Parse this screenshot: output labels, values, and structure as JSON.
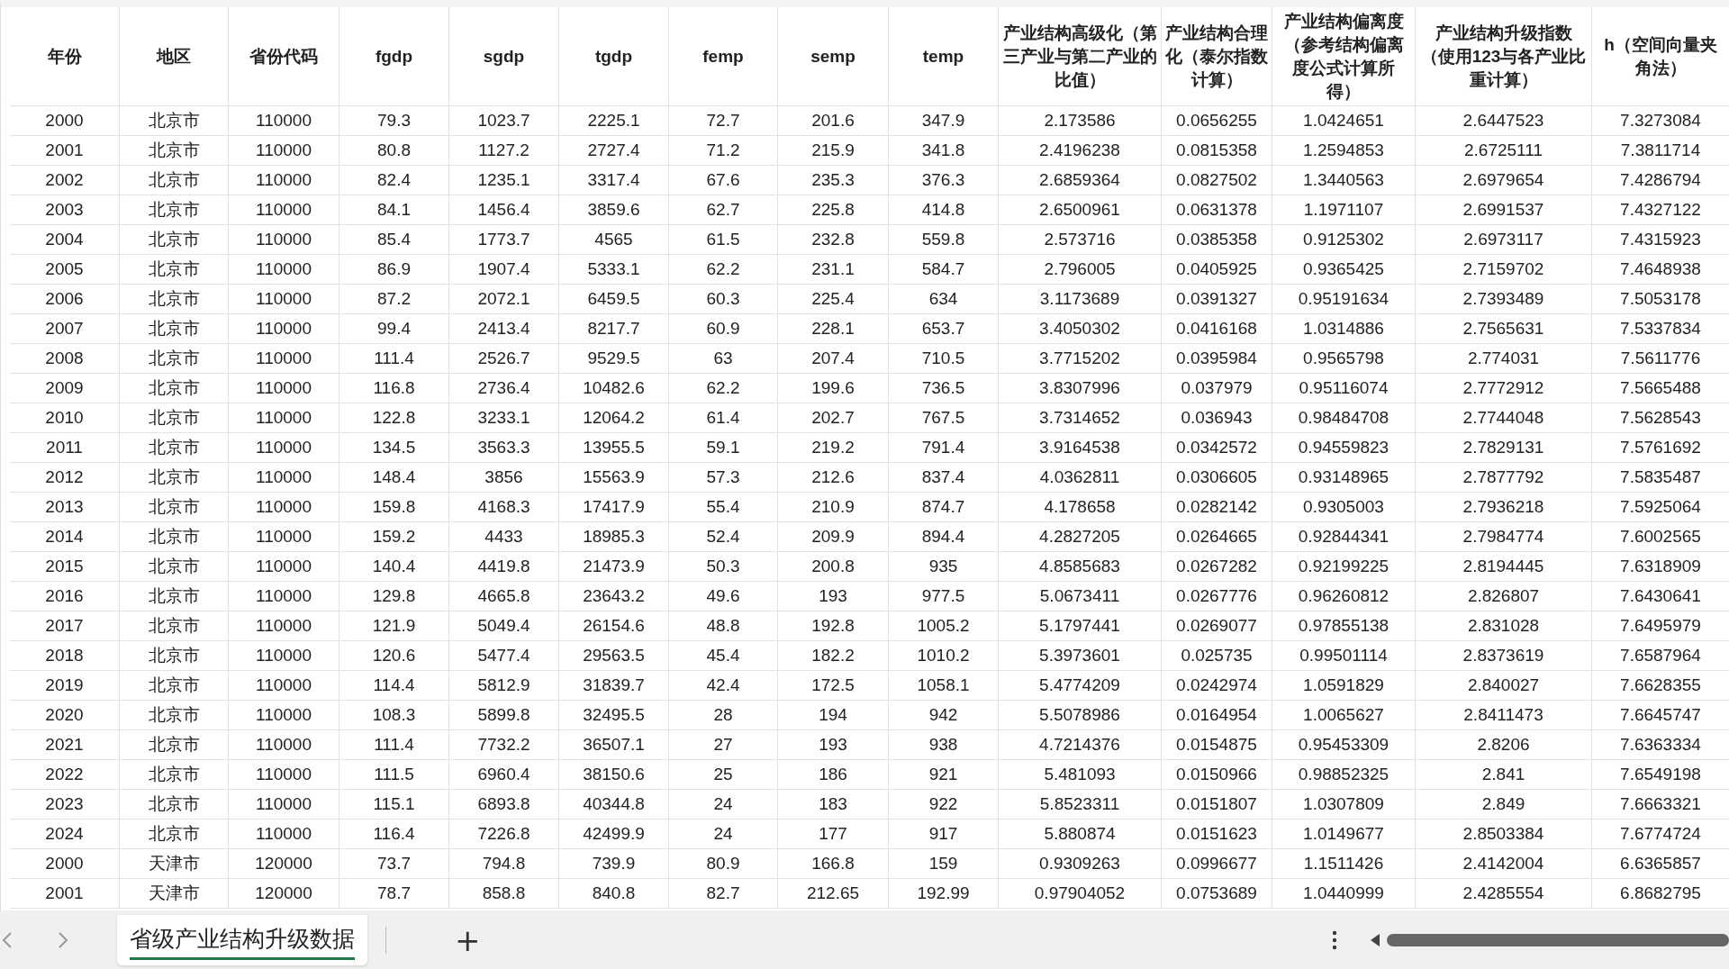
{
  "table": {
    "columns": [
      "年份",
      "地区",
      "省份代码",
      "fgdp",
      "sgdp",
      "tgdp",
      "femp",
      "semp",
      "temp",
      "产业结构高级化（第三产业与第二产业的比值）",
      "产业结构合理化（泰尔指数计算）",
      "产业结构偏离度（参考结构偏离度公式计算所得）",
      "产业结构升级指数（使用123与各产业比重计算）",
      "h（空间向量夹角法）"
    ],
    "rows": [
      [
        "2000",
        "北京市",
        "110000",
        "79.3",
        "1023.7",
        "2225.1",
        "72.7",
        "201.6",
        "347.9",
        "2.173586",
        "0.0656255",
        "1.0424651",
        "2.6447523",
        "7.3273084"
      ],
      [
        "2001",
        "北京市",
        "110000",
        "80.8",
        "1127.2",
        "2727.4",
        "71.2",
        "215.9",
        "341.8",
        "2.4196238",
        "0.0815358",
        "1.2594853",
        "2.6725111",
        "7.3811714"
      ],
      [
        "2002",
        "北京市",
        "110000",
        "82.4",
        "1235.1",
        "3317.4",
        "67.6",
        "235.3",
        "376.3",
        "2.6859364",
        "0.0827502",
        "1.3440563",
        "2.6979654",
        "7.4286794"
      ],
      [
        "2003",
        "北京市",
        "110000",
        "84.1",
        "1456.4",
        "3859.6",
        "62.7",
        "225.8",
        "414.8",
        "2.6500961",
        "0.0631378",
        "1.1971107",
        "2.6991537",
        "7.4327122"
      ],
      [
        "2004",
        "北京市",
        "110000",
        "85.4",
        "1773.7",
        "4565",
        "61.5",
        "232.8",
        "559.8",
        "2.573716",
        "0.0385358",
        "0.9125302",
        "2.6973117",
        "7.4315923"
      ],
      [
        "2005",
        "北京市",
        "110000",
        "86.9",
        "1907.4",
        "5333.1",
        "62.2",
        "231.1",
        "584.7",
        "2.796005",
        "0.0405925",
        "0.9365425",
        "2.7159702",
        "7.4648938"
      ],
      [
        "2006",
        "北京市",
        "110000",
        "87.2",
        "2072.1",
        "6459.5",
        "60.3",
        "225.4",
        "634",
        "3.1173689",
        "0.0391327",
        "0.95191634",
        "2.7393489",
        "7.5053178"
      ],
      [
        "2007",
        "北京市",
        "110000",
        "99.4",
        "2413.4",
        "8217.7",
        "60.9",
        "228.1",
        "653.7",
        "3.4050302",
        "0.0416168",
        "1.0314886",
        "2.7565631",
        "7.5337834"
      ],
      [
        "2008",
        "北京市",
        "110000",
        "111.4",
        "2526.7",
        "9529.5",
        "63",
        "207.4",
        "710.5",
        "3.7715202",
        "0.0395984",
        "0.9565798",
        "2.774031",
        "7.5611776"
      ],
      [
        "2009",
        "北京市",
        "110000",
        "116.8",
        "2736.4",
        "10482.6",
        "62.2",
        "199.6",
        "736.5",
        "3.8307996",
        "0.037979",
        "0.95116074",
        "2.7772912",
        "7.5665488"
      ],
      [
        "2010",
        "北京市",
        "110000",
        "122.8",
        "3233.1",
        "12064.2",
        "61.4",
        "202.7",
        "767.5",
        "3.7314652",
        "0.036943",
        "0.98484708",
        "2.7744048",
        "7.5628543"
      ],
      [
        "2011",
        "北京市",
        "110000",
        "134.5",
        "3563.3",
        "13955.5",
        "59.1",
        "219.2",
        "791.4",
        "3.9164538",
        "0.0342572",
        "0.94559823",
        "2.7829131",
        "7.5761692"
      ],
      [
        "2012",
        "北京市",
        "110000",
        "148.4",
        "3856",
        "15563.9",
        "57.3",
        "212.6",
        "837.4",
        "4.0362811",
        "0.0306605",
        "0.93148965",
        "2.7877792",
        "7.5835487"
      ],
      [
        "2013",
        "北京市",
        "110000",
        "159.8",
        "4168.3",
        "17417.9",
        "55.4",
        "210.9",
        "874.7",
        "4.178658",
        "0.0282142",
        "0.9305003",
        "2.7936218",
        "7.5925064"
      ],
      [
        "2014",
        "北京市",
        "110000",
        "159.2",
        "4433",
        "18985.3",
        "52.4",
        "209.9",
        "894.4",
        "4.2827205",
        "0.0264665",
        "0.92844341",
        "2.7984774",
        "7.6002565"
      ],
      [
        "2015",
        "北京市",
        "110000",
        "140.4",
        "4419.8",
        "21473.9",
        "50.3",
        "200.8",
        "935",
        "4.8585683",
        "0.0267282",
        "0.92199225",
        "2.8194445",
        "7.6318909"
      ],
      [
        "2016",
        "北京市",
        "110000",
        "129.8",
        "4665.8",
        "23643.2",
        "49.6",
        "193",
        "977.5",
        "5.0673411",
        "0.0267776",
        "0.96260812",
        "2.826807",
        "7.6430641"
      ],
      [
        "2017",
        "北京市",
        "110000",
        "121.9",
        "5049.4",
        "26154.6",
        "48.8",
        "192.8",
        "1005.2",
        "5.1797441",
        "0.0269077",
        "0.97855138",
        "2.831028",
        "7.6495979"
      ],
      [
        "2018",
        "北京市",
        "110000",
        "120.6",
        "5477.4",
        "29563.5",
        "45.4",
        "182.2",
        "1010.2",
        "5.3973601",
        "0.025735",
        "0.99501114",
        "2.8373619",
        "7.6587964"
      ],
      [
        "2019",
        "北京市",
        "110000",
        "114.4",
        "5812.9",
        "31839.7",
        "42.4",
        "172.5",
        "1058.1",
        "5.4774209",
        "0.0242974",
        "1.0591829",
        "2.840027",
        "7.6628355"
      ],
      [
        "2020",
        "北京市",
        "110000",
        "108.3",
        "5899.8",
        "32495.5",
        "28",
        "194",
        "942",
        "5.5078986",
        "0.0164954",
        "1.0065627",
        "2.8411473",
        "7.6645747"
      ],
      [
        "2021",
        "北京市",
        "110000",
        "111.4",
        "7732.2",
        "36507.1",
        "27",
        "193",
        "938",
        "4.7214376",
        "0.0154875",
        "0.95453309",
        "2.8206",
        "7.6363334"
      ],
      [
        "2022",
        "北京市",
        "110000",
        "111.5",
        "6960.4",
        "38150.6",
        "25",
        "186",
        "921",
        "5.481093",
        "0.0150966",
        "0.98852325",
        "2.841",
        "7.6549198"
      ],
      [
        "2023",
        "北京市",
        "110000",
        "115.1",
        "6893.8",
        "40344.8",
        "24",
        "183",
        "922",
        "5.8523311",
        "0.0151807",
        "1.0307809",
        "2.849",
        "7.6663321"
      ],
      [
        "2024",
        "北京市",
        "110000",
        "116.4",
        "7226.8",
        "42499.9",
        "24",
        "177",
        "917",
        "5.880874",
        "0.0151623",
        "1.0149677",
        "2.8503384",
        "7.6774724"
      ],
      [
        "2000",
        "天津市",
        "120000",
        "73.7",
        "794.8",
        "739.9",
        "80.9",
        "166.8",
        "159",
        "0.9309263",
        "0.0996677",
        "1.1511426",
        "2.4142004",
        "6.6365857"
      ],
      [
        "2001",
        "天津市",
        "120000",
        "78.7",
        "858.8",
        "840.8",
        "82.7",
        "212.65",
        "192.99",
        "0.97904052",
        "0.0753689",
        "1.0440999",
        "2.4285554",
        "6.8682795"
      ]
    ]
  },
  "sheets": [
    {
      "label": "省级产业结构升级数据",
      "selected": true
    }
  ],
  "add_sheet": "+"
}
